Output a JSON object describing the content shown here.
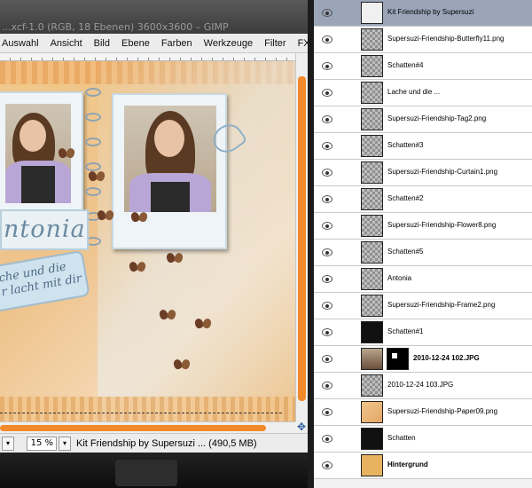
{
  "window": {
    "title": "...xcf-1.0 (RGB, 18 Ebenen) 3600x3600 – GIMP"
  },
  "menu": [
    "Auswahl",
    "Ansicht",
    "Bild",
    "Ebene",
    "Farben",
    "Werkzeuge",
    "Filter",
    "FX-Fou"
  ],
  "canvas": {
    "name_text": "ntonia",
    "quote_line1": "che und die",
    "quote_line2": "r lacht mit dir"
  },
  "statusbar": {
    "unit_arrow": "▾",
    "zoom": "15 %",
    "zoom_arrow": "▾",
    "status": "Kit Friendship by Supersuzi     ... (490,5 MB)"
  },
  "layers": [
    {
      "name": "Kit Friendship by Supersuzi",
      "thumb": "text",
      "selected": true,
      "bold": false,
      "mask": false
    },
    {
      "name": "Supersuzi-Friendship-Butterfly11.png",
      "thumb": "checker",
      "selected": false,
      "bold": false,
      "mask": false
    },
    {
      "name": "Schatten#4",
      "thumb": "checker",
      "selected": false,
      "bold": false,
      "mask": false
    },
    {
      "name": "Lache und die ...",
      "thumb": "checker",
      "selected": false,
      "bold": false,
      "mask": false
    },
    {
      "name": "Supersuzi-Friendship-Tag2.png",
      "thumb": "checker",
      "selected": false,
      "bold": false,
      "mask": false
    },
    {
      "name": "Schatten#3",
      "thumb": "checker",
      "selected": false,
      "bold": false,
      "mask": false
    },
    {
      "name": "Supersuzi-Friendship-Curtain1.png",
      "thumb": "checker",
      "selected": false,
      "bold": false,
      "mask": false
    },
    {
      "name": "Schatten#2",
      "thumb": "checker",
      "selected": false,
      "bold": false,
      "mask": false
    },
    {
      "name": "Supersuzi-Friendship-Flower8.png",
      "thumb": "checker",
      "selected": false,
      "bold": false,
      "mask": false
    },
    {
      "name": "Schatten#5",
      "thumb": "checker",
      "selected": false,
      "bold": false,
      "mask": false
    },
    {
      "name": "Antonia",
      "thumb": "checker",
      "selected": false,
      "bold": false,
      "mask": false
    },
    {
      "name": "Supersuzi-Friendship-Frame2.png",
      "thumb": "checker",
      "selected": false,
      "bold": false,
      "mask": false
    },
    {
      "name": "Schatten#1",
      "thumb": "black",
      "selected": false,
      "bold": false,
      "mask": false
    },
    {
      "name": "2010-12-24 102.JPG",
      "thumb": "photo",
      "selected": false,
      "bold": true,
      "mask": true
    },
    {
      "name": "2010-12-24 103.JPG",
      "thumb": "checker",
      "selected": false,
      "bold": false,
      "mask": false
    },
    {
      "name": "Supersuzi-Friendship-Paper09.png",
      "thumb": "paper",
      "selected": false,
      "bold": false,
      "mask": false
    },
    {
      "name": "Schatten",
      "thumb": "black",
      "selected": false,
      "bold": false,
      "mask": false
    },
    {
      "name": "Hintergrund",
      "thumb": "orange",
      "selected": false,
      "bold": true,
      "mask": false
    }
  ]
}
